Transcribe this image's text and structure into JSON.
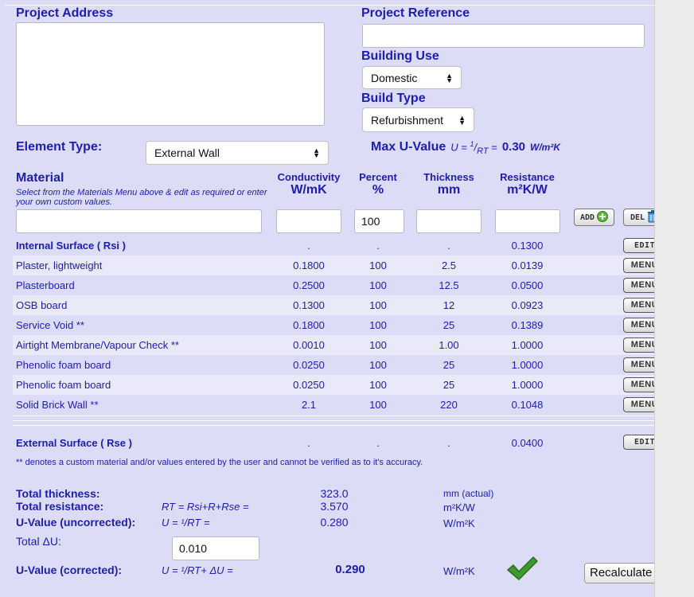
{
  "project": {
    "address_label": "Project Address",
    "address_value": "",
    "reference_label": "Project Reference",
    "reference_value": "",
    "building_use_label": "Building Use",
    "building_use_value": "Domestic",
    "build_type_label": "Build Type",
    "build_type_value": "Refurbishment"
  },
  "element": {
    "label": "Element Type:",
    "value": "External Wall",
    "max_u_label": "Max U-Value",
    "max_u_formula_u": "U =",
    "max_u_formula_num": "1",
    "max_u_formula_den": "RT",
    "max_u_formula_eq": "=",
    "max_u_value": "0.30",
    "max_u_unit": "W/m²K"
  },
  "columns": {
    "material": "Material",
    "material_hint": "Select from the Materials Menu above & edit as required or enter your own custom values.",
    "conductivity": "Conductivity",
    "conductivity_unit": "W/mK",
    "percent": "Percent",
    "percent_unit": "%",
    "thickness": "Thickness",
    "thickness_unit": "mm",
    "resistance": "Resistance",
    "resistance_unit": "m²K/W"
  },
  "entry": {
    "material": "",
    "conductivity": "",
    "percent": "100",
    "thickness": "",
    "resistance": "",
    "add_label": "ADD",
    "del_label": "DEL"
  },
  "rows": [
    {
      "name": "Internal Surface ( Rsi )",
      "conductivity": ".",
      "percent": ".",
      "thickness": ".",
      "resistance": "0.1300",
      "action": "EDIT",
      "bold": true
    },
    {
      "name": "Plaster, lightweight",
      "conductivity": "0.1800",
      "percent": "100",
      "thickness": "2.5",
      "resistance": "0.0139",
      "action": "MENU"
    },
    {
      "name": "Plasterboard",
      "conductivity": "0.2500",
      "percent": "100",
      "thickness": "12.5",
      "resistance": "0.0500",
      "action": "MENU"
    },
    {
      "name": "OSB board",
      "conductivity": "0.1300",
      "percent": "100",
      "thickness": "12",
      "resistance": "0.0923",
      "action": "MENU"
    },
    {
      "name": "Service Void **",
      "conductivity": "0.1800",
      "percent": "100",
      "thickness": "25",
      "resistance": "0.1389",
      "action": "MENU"
    },
    {
      "name": "Airtight Membrane/Vapour Check **",
      "conductivity": "0.0010",
      "percent": "100",
      "thickness": "1.00",
      "resistance": "1.0000",
      "action": "MENU"
    },
    {
      "name": "Phenolic foam board",
      "conductivity": "0.0250",
      "percent": "100",
      "thickness": "25",
      "resistance": "1.0000",
      "action": "MENU"
    },
    {
      "name": "Phenolic foam board",
      "conductivity": "0.0250",
      "percent": "100",
      "thickness": "25",
      "resistance": "1.0000",
      "action": "MENU"
    },
    {
      "name": "Solid Brick Wall **",
      "conductivity": "2.1",
      "percent": "100",
      "thickness": "220",
      "resistance": "0.1048",
      "action": "MENU"
    }
  ],
  "external": {
    "name": "External Surface ( Rse )",
    "conductivity": ".",
    "percent": ".",
    "thickness": ".",
    "resistance": "0.0400",
    "action": "EDIT"
  },
  "note": "** denotes a custom material and/or values entered by the user and cannot be verified as to it's accuracy.",
  "totals": {
    "thickness_label": "Total thickness:",
    "thickness_value": "323.0",
    "thickness_unit": "mm (actual)",
    "resistance_label": "Total resistance:",
    "resistance_formula": "RT = Rsi+R+Rse =",
    "resistance_value": "3.570",
    "resistance_unit": "m²K/W",
    "u_uncorr_label": "U-Value (uncorrected):",
    "u_uncorr_formula": "U = ¹/RT =",
    "u_uncorr_value": "0.280",
    "u_uncorr_unit": "W/m²K",
    "delta_label": "Total ΔU:",
    "delta_value": "0.010",
    "u_corr_label": "U-Value (corrected):",
    "u_corr_formula": "U = ¹/RT+ ΔU =",
    "u_corr_value": "0.290",
    "u_corr_unit": "W/m²K",
    "recalc_label": "Recalculate"
  },
  "colors": {
    "accent": "#1d1db0",
    "background": "#dcdcf6",
    "check": "#3d9a2e"
  }
}
